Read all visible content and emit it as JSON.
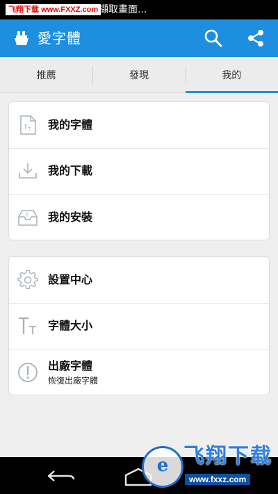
{
  "status_bar": {
    "watermark_site": "飞翔下载",
    "watermark_url": "www.FXXZ.com",
    "text": "擷取畫面..."
  },
  "app_bar": {
    "title": "愛字體",
    "icons": [
      "app-logo-icon",
      "search-icon",
      "share-icon"
    ]
  },
  "tabs": [
    {
      "label": "推薦"
    },
    {
      "label": "發現"
    },
    {
      "label": "我的",
      "active": true
    }
  ],
  "section1": {
    "items": [
      {
        "label": "我的字體",
        "icon": "font-file-icon"
      },
      {
        "label": "我的下載",
        "icon": "download-icon"
      },
      {
        "label": "我的安裝",
        "icon": "install-tray-icon"
      }
    ]
  },
  "section2": {
    "items": [
      {
        "label": "設置中心",
        "icon": "gear-icon"
      },
      {
        "label": "字體大小",
        "icon": "font-size-icon"
      },
      {
        "label": "出廠字體",
        "sublabel": "恢復出廠字體",
        "icon": "exclamation-circle-icon"
      }
    ]
  },
  "watermark": {
    "title": "飞翔下载",
    "url": "www.fxxz.com"
  },
  "colors": {
    "primary": "#1e8fdf",
    "background": "#efefef",
    "icon_gray": "#a7b1bb"
  }
}
